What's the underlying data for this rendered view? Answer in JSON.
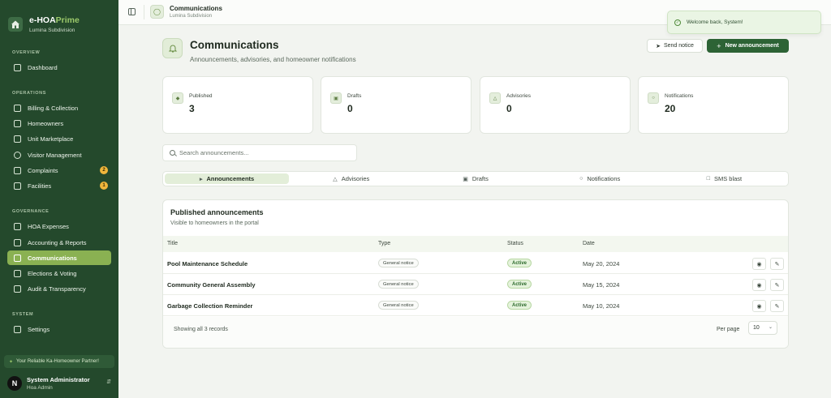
{
  "brand": {
    "name_a": "e-HOA",
    "name_b": "Prime",
    "subdivision": "Lumina Subdivision"
  },
  "sidebar": {
    "sections": [
      {
        "label": "OVERVIEW",
        "items": [
          {
            "label": "Dashboard",
            "icon": "grid-icon"
          }
        ]
      },
      {
        "label": "OPERATIONS",
        "items": [
          {
            "label": "Billing & Collection",
            "icon": "wallet-icon"
          },
          {
            "label": "Homeowners",
            "icon": "home-icon"
          },
          {
            "label": "Unit Marketplace",
            "icon": "store-icon"
          },
          {
            "label": "Visitor Management",
            "icon": "shield-icon"
          },
          {
            "label": "Complaints",
            "icon": "clipboard-icon",
            "badge": "2"
          },
          {
            "label": "Facilities",
            "icon": "building-icon",
            "badge": "1"
          }
        ]
      },
      {
        "label": "GOVERNANCE",
        "items": [
          {
            "label": "HOA Expenses",
            "icon": "receipt-icon"
          },
          {
            "label": "Accounting & Reports",
            "icon": "chart-icon"
          },
          {
            "label": "Communications",
            "icon": "megaphone-icon",
            "active": true
          },
          {
            "label": "Elections & Voting",
            "icon": "vote-icon"
          },
          {
            "label": "Audit & Transparency",
            "icon": "audit-icon"
          }
        ]
      },
      {
        "label": "SYSTEM",
        "items": [
          {
            "label": "Settings",
            "icon": "gear-icon"
          }
        ]
      }
    ],
    "partner_text": "Your Reliable Ka-Homeowner Partner!",
    "user": {
      "initial": "N",
      "name": "System Administrator",
      "role": "Hoa Admin"
    }
  },
  "topbar": {
    "title": "Communications",
    "subtitle": "Lumina Subdivision"
  },
  "toast": {
    "message": "Welcome back, System!"
  },
  "header": {
    "title": "Communications",
    "subtitle": "Announcements, advisories, and homeowner notifications",
    "send_label": "Send notice",
    "new_label": "New announcement"
  },
  "stats": [
    {
      "label": "Published",
      "value": "3",
      "icon": "megaphone-icon"
    },
    {
      "label": "Drafts",
      "value": "0",
      "icon": "file-icon"
    },
    {
      "label": "Advisories",
      "value": "0",
      "icon": "alert-icon"
    },
    {
      "label": "Notifications",
      "value": "20",
      "icon": "bell-icon"
    }
  ],
  "search": {
    "placeholder": "Search announcements...",
    "value": ""
  },
  "tabs": [
    {
      "label": "Announcements",
      "icon": "megaphone-icon",
      "active": true
    },
    {
      "label": "Advisories",
      "icon": "alert-icon"
    },
    {
      "label": "Drafts",
      "icon": "file-icon"
    },
    {
      "label": "Notifications",
      "icon": "bell-icon"
    },
    {
      "label": "SMS blast",
      "icon": "message-icon"
    }
  ],
  "table": {
    "title": "Published announcements",
    "subtitle": "Visible to homeowners in the portal",
    "columns": [
      "Title",
      "Type",
      "Status",
      "Date"
    ],
    "rows": [
      {
        "title": "Pool Maintenance Schedule",
        "type": "General notice",
        "status": "Active",
        "date": "May 20, 2024"
      },
      {
        "title": "Community General Assembly",
        "type": "General notice",
        "status": "Active",
        "date": "May 15, 2024"
      },
      {
        "title": "Garbage Collection Reminder",
        "type": "General notice",
        "status": "Active",
        "date": "May 10, 2024"
      }
    ],
    "footer_text": "Showing all 3 records",
    "per_page_label": "Per page",
    "per_page_value": "10"
  }
}
